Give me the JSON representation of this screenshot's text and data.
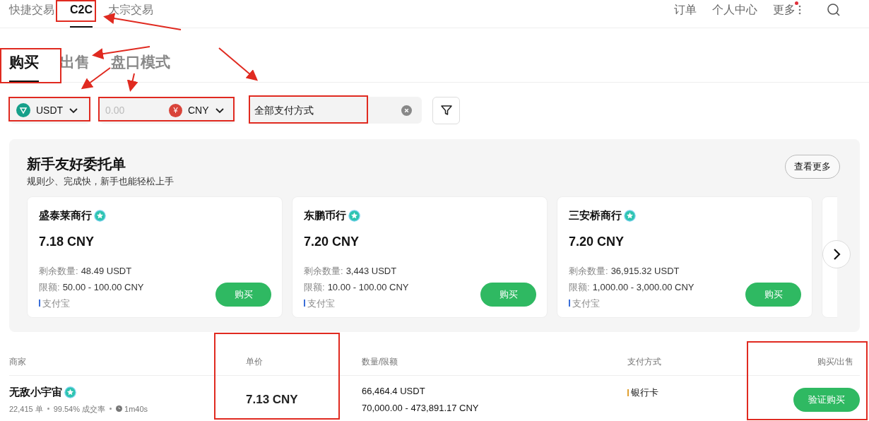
{
  "nav": {
    "tabs": [
      {
        "label": "快捷交易",
        "selected": false
      },
      {
        "label": "C2C",
        "selected": true
      },
      {
        "label": "大宗交易",
        "selected": false
      }
    ],
    "links": [
      "订单",
      "个人中心",
      "更多"
    ],
    "more_dot": true
  },
  "mode_tabs": [
    {
      "label": "购买",
      "selected": true
    },
    {
      "label": "出售",
      "selected": false
    },
    {
      "label": "盘口模式",
      "selected": false
    }
  ],
  "filters": {
    "coin": "USDT",
    "amount": {
      "placeholder": "0.00"
    },
    "currency_symbol": "¥",
    "currency": "CNY",
    "payment": "全部支付方式"
  },
  "featured": {
    "title": "新手友好委托单",
    "subtitle": "规则少、完成快，新手也能轻松上手",
    "more_button": "查看更多",
    "cards": [
      {
        "merchant": "盛泰莱商行",
        "price": "7.18 CNY",
        "remaining_label": "剩余数量:",
        "remaining": "48.49 USDT",
        "limit_label": "限额:",
        "limit": "50.00 - 100.00 CNY",
        "payment": {
          "label": "支付宝",
          "color": "#3b6fd8"
        },
        "buy_label": "购买"
      },
      {
        "merchant": "东鹏币行",
        "price": "7.20 CNY",
        "remaining_label": "剩余数量:",
        "remaining": "3,443 USDT",
        "limit_label": "限额:",
        "limit": "10.00 - 100.00 CNY",
        "payment": {
          "label": "支付宝",
          "color": "#3b6fd8"
        },
        "buy_label": "购买"
      },
      {
        "merchant": "三安桥商行",
        "price": "7.20 CNY",
        "remaining_label": "剩余数量:",
        "remaining": "36,915.32 USDT",
        "limit_label": "限额:",
        "limit": "1,000.00 - 3,000.00 CNY",
        "payment": {
          "label": "支付宝",
          "color": "#3b6fd8"
        },
        "buy_label": "购买"
      }
    ]
  },
  "table": {
    "columns": [
      "商家",
      "单价",
      "数量/限额",
      "支付方式",
      "购买/出售"
    ],
    "rows": [
      {
        "merchant": "无敌小宇宙",
        "orders": "22,415 单",
        "completion": "99.54% 成交率",
        "time": "1m40s",
        "price": "7.13 CNY",
        "quantity": "66,464.4 USDT",
        "limit": "70,000.00 - 473,891.17 CNY",
        "payment": {
          "label": "银行卡",
          "color": "#e0a030"
        },
        "action": "验证购买"
      }
    ]
  }
}
